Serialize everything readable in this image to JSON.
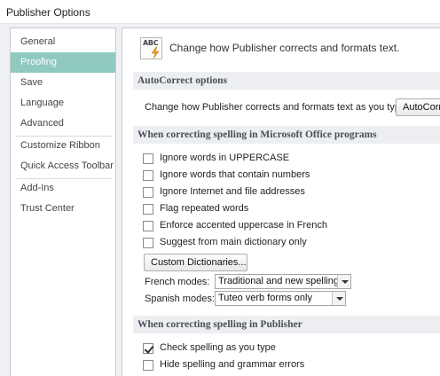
{
  "window": {
    "title": "Publisher Options"
  },
  "sidebar": {
    "items": [
      {
        "label": "General",
        "selected": false
      },
      {
        "label": "Proofing",
        "selected": true
      },
      {
        "label": "Save",
        "selected": false
      },
      {
        "label": "Language",
        "selected": false
      },
      {
        "label": "Advanced",
        "selected": false
      },
      {
        "label": "Customize Ribbon",
        "selected": false
      },
      {
        "label": "Quick Access Toolbar",
        "selected": false
      },
      {
        "label": "Add-Ins",
        "selected": false
      },
      {
        "label": "Trust Center",
        "selected": false
      }
    ],
    "selected_color": "#8fc9bf"
  },
  "header": {
    "icon": "abc-autocorrect-icon",
    "icon_text": "ABC",
    "text": "Change how Publisher corrects and formats text."
  },
  "autocorrect": {
    "heading": "AutoCorrect options",
    "description": "Change how Publisher corrects and formats text as you type:",
    "button_label": "AutoCorrect Options..."
  },
  "office_spelling": {
    "heading": "When correcting spelling in Microsoft Office programs",
    "options": [
      {
        "label": "Ignore words in UPPERCASE",
        "checked": false
      },
      {
        "label": "Ignore words that contain numbers",
        "checked": false
      },
      {
        "label": "Ignore Internet and file addresses",
        "checked": false
      },
      {
        "label": "Flag repeated words",
        "checked": false
      },
      {
        "label": "Enforce accented uppercase in French",
        "checked": false
      },
      {
        "label": "Suggest from main dictionary only",
        "checked": false
      }
    ],
    "custom_dictionaries_label": "Custom Dictionaries...",
    "french_modes": {
      "label": "French modes:",
      "value": "Traditional and new spellings"
    },
    "spanish_modes": {
      "label": "Spanish modes:",
      "value": "Tuteo verb forms only"
    }
  },
  "publisher_spelling": {
    "heading": "When correcting spelling in Publisher",
    "options": [
      {
        "label": "Check spelling as you type",
        "checked": true
      },
      {
        "label": "Hide spelling and grammar errors",
        "checked": false
      }
    ]
  }
}
